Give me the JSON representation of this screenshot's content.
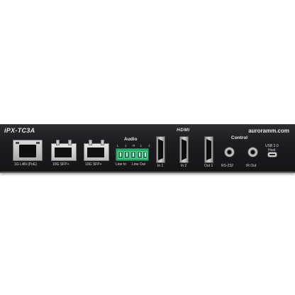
{
  "device": {
    "model": "iPX-TC3A",
    "brand": "auroramm.com",
    "sections": {
      "audio": "Audio",
      "hdmi": "HDMI",
      "control": "Control"
    },
    "ports": {
      "lan": "1G LAN (PoE)",
      "sfp1": "10G SFP+",
      "sfp2": "10G SFP+",
      "line_in": "Line In",
      "line_out": "Line Out",
      "in1": "In 1",
      "in2": "In 2",
      "out1": "Out 1",
      "rs232": "RS-232",
      "ir_out": "IR Out",
      "usb": "USB 2.0",
      "usb_host": "Host"
    },
    "audio_pin_marks": "L ⏚ R L ⏚ R"
  },
  "colors": {
    "panel": "#1b1c1f",
    "terminal_green": "#2aa66a",
    "label": "#e6e6e6"
  }
}
